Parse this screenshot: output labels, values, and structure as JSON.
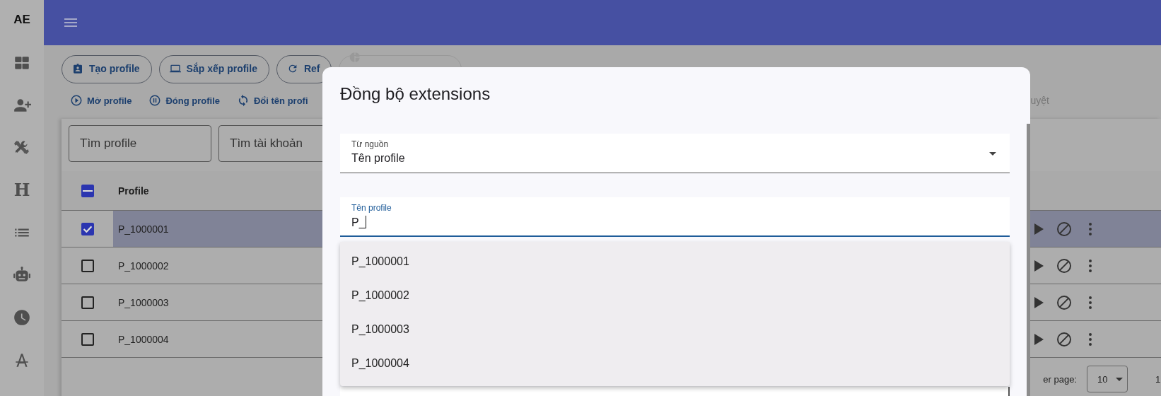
{
  "sidebar": {
    "logo": "AE",
    "heading_glyph": "H"
  },
  "toolbar": {
    "buttons": [
      {
        "label": "Tạo profile",
        "disabled": false
      },
      {
        "label": "Sắp xếp profile",
        "disabled": false
      },
      {
        "label": "Ref",
        "disabled": false
      },
      {
        "disabled": true
      }
    ]
  },
  "actions": [
    {
      "label": "Mở profile",
      "disabled": false
    },
    {
      "label": "Đóng profile",
      "disabled": false
    },
    {
      "label": "Đổi tên profi",
      "disabled": false
    },
    {
      "label": "uyệt",
      "disabled": true
    }
  ],
  "search": [
    {
      "placeholder": "Tìm profile"
    },
    {
      "placeholder": "Tìm tài khoản"
    }
  ],
  "table": {
    "header_indeterminate": true,
    "columns": [
      "Profile"
    ],
    "rows": [
      {
        "profile": "P_1000001",
        "checked": true,
        "selected": true
      },
      {
        "profile": "P_1000002",
        "checked": false,
        "selected": false
      },
      {
        "profile": "P_1000003",
        "checked": false,
        "selected": false
      },
      {
        "profile": "P_1000004",
        "checked": false,
        "selected": false
      }
    ]
  },
  "pagination": {
    "label": "er page:",
    "rows_per_page": "10",
    "range": "1"
  },
  "dialog": {
    "title": "Đồng bộ extensions",
    "fields": [
      {
        "kind": "select",
        "label": "Từ nguồn",
        "value": "Tên profile",
        "focused": false
      },
      {
        "kind": "text",
        "label": "Tên profile",
        "value": "P_",
        "focused": true
      }
    ],
    "options": [
      "P_1000001",
      "P_1000002",
      "P_1000003",
      "P_1000004"
    ]
  }
}
